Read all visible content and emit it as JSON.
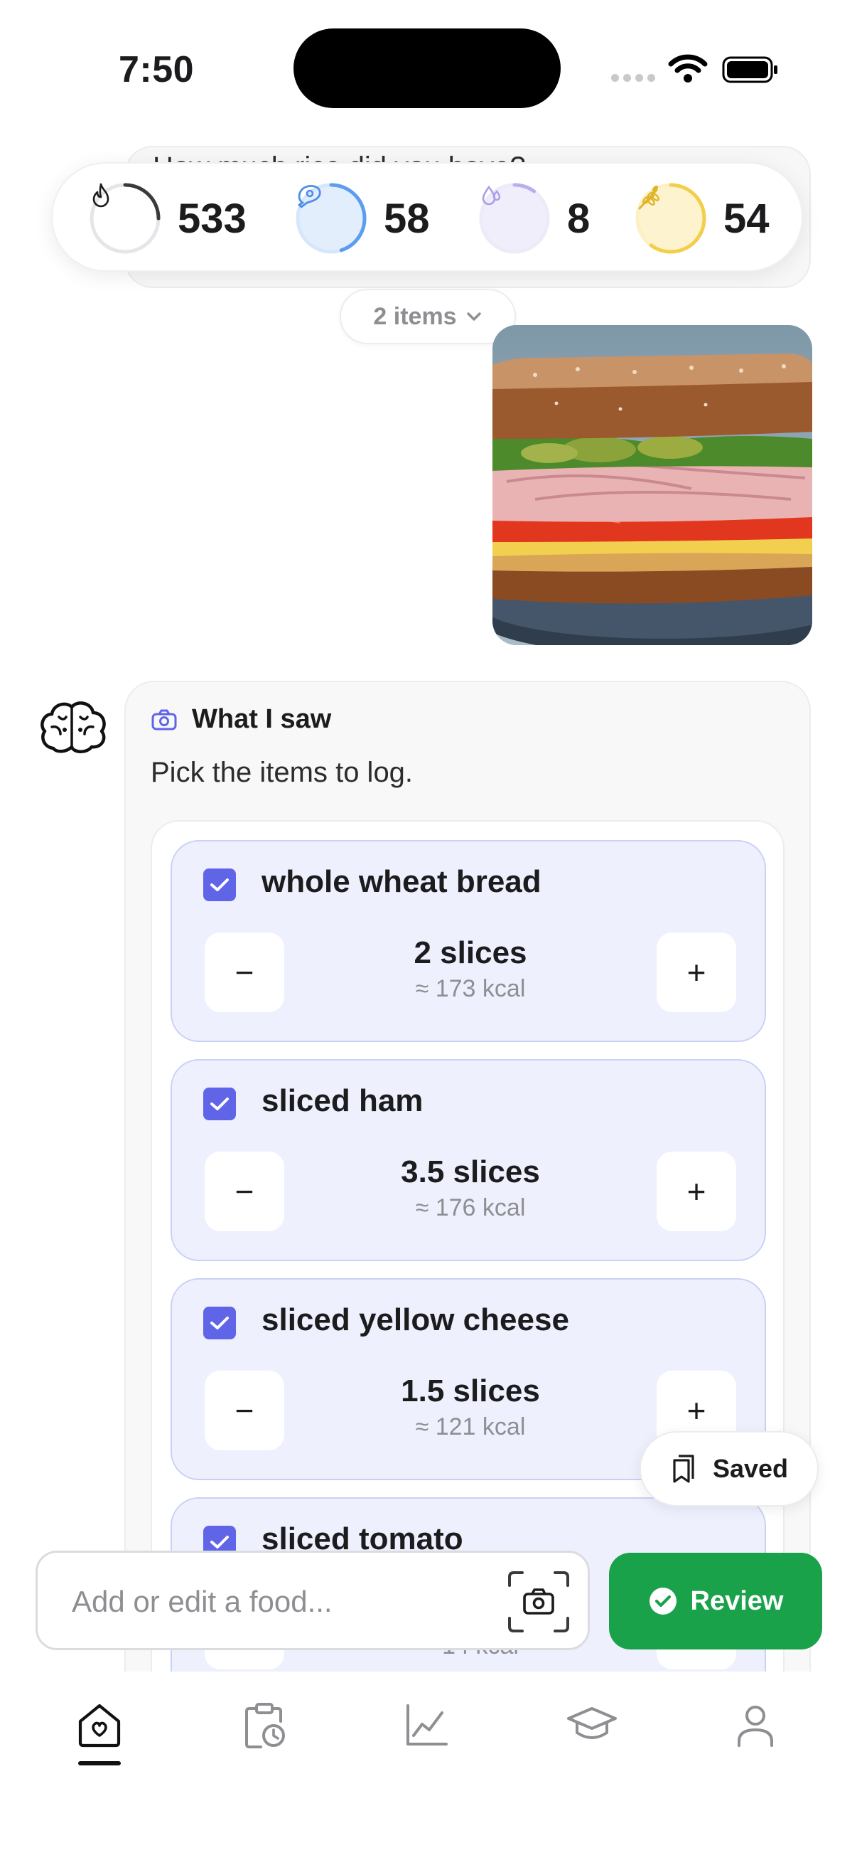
{
  "status_bar": {
    "time": "7:50"
  },
  "previous_question": "How much rice did you have?",
  "macros": [
    {
      "name": "calories",
      "value": "533",
      "icon": "flame-icon",
      "color": "#3a3a3c",
      "progress": 0.25
    },
    {
      "name": "protein",
      "value": "58",
      "icon": "meat-icon",
      "color": "#5b9ef0",
      "progress": 0.45
    },
    {
      "name": "fat",
      "value": "8",
      "icon": "drop-icon",
      "color": "#b8aef0",
      "progress": 0.1
    },
    {
      "name": "carbs",
      "value": "54",
      "icon": "wheat-icon",
      "color": "#f2cf4a",
      "progress": 0.6
    }
  ],
  "items_chip": {
    "label": "2 items"
  },
  "card": {
    "title": "What I saw",
    "subtitle": "Pick the items to log."
  },
  "food_items": [
    {
      "name": "whole wheat bread",
      "quantity": "2 slices",
      "kcal": "≈ 173 kcal",
      "checked": true
    },
    {
      "name": "sliced ham",
      "quantity": "3.5 slices",
      "kcal": "≈ 176 kcal",
      "checked": true
    },
    {
      "name": "sliced yellow cheese",
      "quantity": "1.5 slices",
      "kcal": "≈ 121 kcal",
      "checked": true
    },
    {
      "name": "sliced tomato",
      "quantity": "",
      "kcal": "≈ 14 kcal",
      "checked": true
    }
  ],
  "stepper": {
    "minus": "−",
    "plus": "+"
  },
  "saved_pill": {
    "label": "Saved"
  },
  "input": {
    "placeholder": "Add or edit a food..."
  },
  "review_button": {
    "label": "Review"
  },
  "colors": {
    "accent": "#6065e8",
    "review_green": "#1aa24a",
    "item_bg": "#eef1fd"
  },
  "tabs": [
    {
      "name": "home",
      "icon": "home-heart-icon",
      "active": true
    },
    {
      "name": "history",
      "icon": "clipboard-clock-icon",
      "active": false
    },
    {
      "name": "progress",
      "icon": "chart-icon",
      "active": false
    },
    {
      "name": "learn",
      "icon": "graduation-cap-icon",
      "active": false
    },
    {
      "name": "profile",
      "icon": "person-icon",
      "active": false
    }
  ]
}
